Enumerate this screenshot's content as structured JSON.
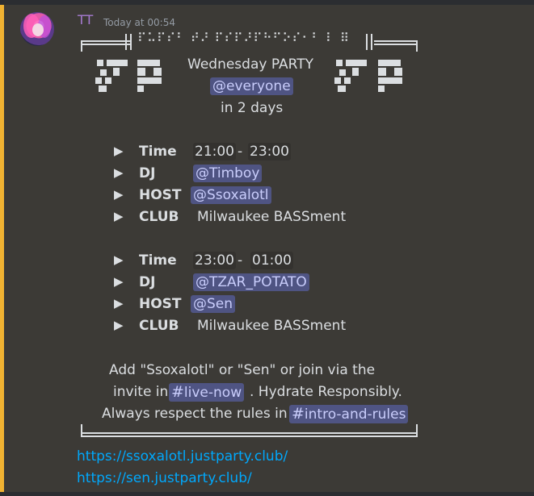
{
  "message": {
    "username": "TT",
    "timestamp": "Today at 00:54",
    "braille_banner": "⠏⠥⠏⠎⠃ ⠞⠜ ⠏⠎⠏⠜⠏⠓⠋⠕⠎⠂⠃ ⠇ ⠿",
    "header": {
      "line1": "Wednesday PARTY",
      "mention": "@everyone",
      "line3": "in 2 days"
    },
    "blocks": [
      {
        "rows": [
          {
            "arrow": "▶",
            "label": "Time",
            "value": "21:00",
            "sep": "-",
            "value2": "23:00"
          },
          {
            "arrow": "▶",
            "label": "DJ",
            "mention": "@Timboy"
          },
          {
            "arrow": "▶",
            "label": "HOST",
            "mention": "@Ssoxalotl"
          },
          {
            "arrow": "▶",
            "label": "CLUB",
            "text": "Milwaukee BASSment"
          }
        ]
      },
      {
        "rows": [
          {
            "arrow": "▶",
            "label": "Time",
            "value": "23:00",
            "sep": "-",
            "value2": "01:00"
          },
          {
            "arrow": "▶",
            "label": "DJ",
            "mention": "@TZAR_POTATO"
          },
          {
            "arrow": "▶",
            "label": "HOST",
            "mention": "@Sen"
          },
          {
            "arrow": "▶",
            "label": "CLUB",
            "text": "Milwaukee BASSment"
          }
        ]
      }
    ],
    "footer": {
      "line1": "Add \"Ssoxalotl\" or \"Sen\" or join via the",
      "line2_pre": "invite in",
      "channel1": "live-now",
      "line2_post": ". Hydrate Responsibly.",
      "line3_pre": "Always respect the rules in",
      "channel2": "intro-and-rules",
      "hash": "#"
    },
    "links": [
      "https://ssoxalotl.justparty.club/",
      "https://sen.justparty.club/"
    ]
  },
  "colors": {
    "accent_bar": "#f0b232",
    "username": "#a67bd1",
    "mention_bg": "#4f5483",
    "link": "#00a8fc"
  }
}
